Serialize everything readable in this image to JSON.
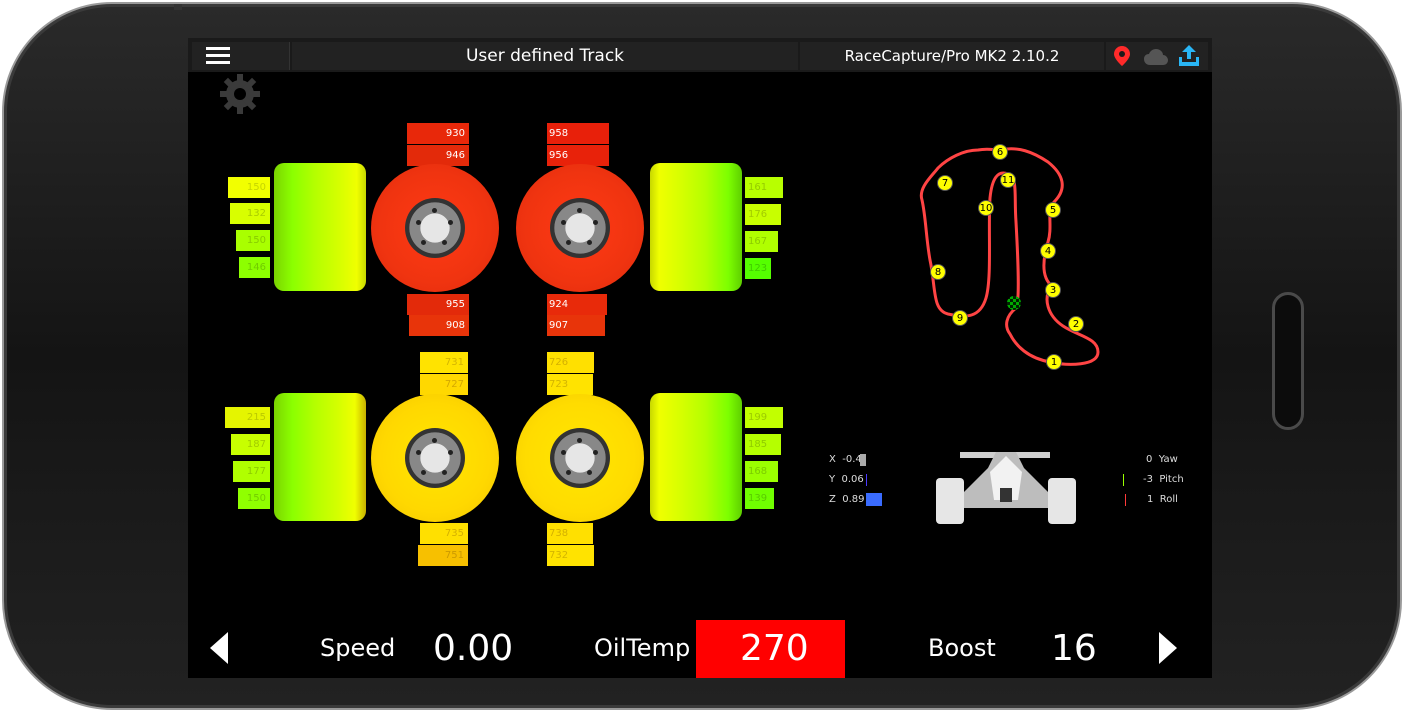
{
  "header": {
    "track_title": "User defined Track",
    "device_name": "RaceCapture/Pro MK2 2.10.2",
    "icons": [
      "hamburger-menu-icon",
      "location-pin-icon",
      "cloud-icon",
      "upload-icon"
    ]
  },
  "tires": {
    "front_left": {
      "outer_temps": [
        "150",
        "132",
        "150",
        "146"
      ],
      "brake_temps_top": [
        "930",
        "946"
      ],
      "brake_temps_bottom": [
        "955",
        "908"
      ]
    },
    "front_right": {
      "outer_temps": [
        "161",
        "176",
        "167",
        "123"
      ],
      "brake_temps_top": [
        "958",
        "956"
      ],
      "brake_temps_bottom": [
        "924",
        "907"
      ]
    },
    "rear_left": {
      "outer_temps": [
        "215",
        "187",
        "177",
        "150"
      ],
      "brake_temps_top": [
        "731",
        "727"
      ],
      "brake_temps_bottom": [
        "735",
        "751"
      ]
    },
    "rear_right": {
      "outer_temps": [
        "199",
        "185",
        "168",
        "139"
      ],
      "brake_temps_top": [
        "726",
        "723"
      ],
      "brake_temps_bottom": [
        "738",
        "732"
      ]
    }
  },
  "track_map": {
    "sector_labels": [
      "1",
      "2",
      "3",
      "4",
      "5",
      "6",
      "7",
      "8",
      "9",
      "10",
      "11"
    ]
  },
  "imu": {
    "accel": [
      {
        "axis": "X",
        "value": "-0.4"
      },
      {
        "axis": "Y",
        "value": "0.06"
      },
      {
        "axis": "Z",
        "value": "0.89"
      }
    ],
    "gyro": [
      {
        "value": "0",
        "label": "Yaw"
      },
      {
        "value": "-3",
        "label": "Pitch"
      },
      {
        "value": "1",
        "label": "Roll"
      }
    ]
  },
  "gauges": {
    "speed": {
      "label": "Speed",
      "value": "0.00"
    },
    "oiltemp": {
      "label": "OilTemp",
      "value": "270",
      "alert_color": "#ff0000"
    },
    "boost": {
      "label": "Boost",
      "value": "16"
    }
  },
  "colors": {
    "hot": "#ff3300",
    "warm": "#ffd400",
    "cool": "#66ff00",
    "track": "#ff4444",
    "sector_marker": "#ffff00",
    "accent": "#29b6f6"
  }
}
